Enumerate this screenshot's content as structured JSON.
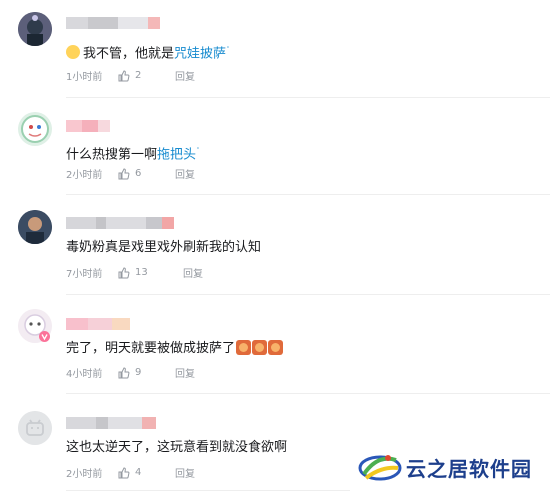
{
  "comments": [
    {
      "name_colors": [
        "#d8d8dc",
        "#c9c9cd",
        "#e6e6ea",
        "#f4b8b8"
      ],
      "emoji": "blush-emoji",
      "text_prefix": "我不管，他就是",
      "link": "咒娃披萨",
      "link_marker": "ʿ",
      "time": "1小时前",
      "likes": "2",
      "reply": "回复"
    },
    {
      "name_colors": [
        "#f9c7cf",
        "#f5b0bb",
        "#f7d9de"
      ],
      "text_prefix": "什么热搜第一啊",
      "link": "拖把头",
      "link_marker": "ʿ",
      "time": "2小时前",
      "likes": "6",
      "reply": "回复"
    },
    {
      "name_colors": [
        "#d6d6da",
        "#c4c4c8",
        "#dcdce0",
        "#c7c7cc",
        "#f2a6a6"
      ],
      "text": "毒奶粉真是戏里戏外刷新我的认知",
      "time": "7小时前",
      "likes": "13",
      "reply": "回复"
    },
    {
      "name_colors": [
        "#f8c0cc",
        "#f6d0d8",
        "#f9d9c0"
      ],
      "text": "完了，明天就要被做成披萨了",
      "stickers": [
        "scream-sticker",
        "scream-sticker",
        "scream-sticker"
      ],
      "time": "4小时前",
      "likes": "9",
      "reply": "回复"
    },
    {
      "name_colors": [
        "#d8d8dc",
        "#c6c6ca",
        "#e0e0e4",
        "#f1b2b2"
      ],
      "text": "这也太逆天了，这玩意看到就没食欲啊",
      "time": "2小时前",
      "likes": "4",
      "reply": "回复"
    }
  ],
  "watermark": {
    "text": "云之居软件园",
    "logo": "yunzhiju-logo"
  },
  "icons": {
    "like": "thumbs-up-icon"
  }
}
